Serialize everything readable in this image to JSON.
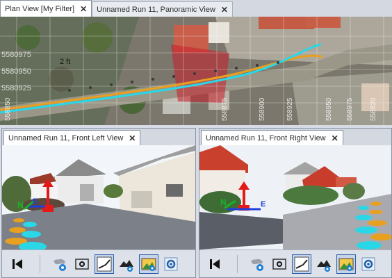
{
  "top_pane": {
    "tabs": [
      {
        "label": "Plan View [My Filter]",
        "close": "✕",
        "active": true
      },
      {
        "label": "Unnamed Run  11, Panoramic View",
        "close": "✕",
        "active": false
      }
    ],
    "grid_labels": {
      "y": [
        "5580975",
        "5580950",
        "5580925"
      ],
      "x": [
        "558850",
        "558875",
        "558900",
        "558925",
        "558950",
        "558975",
        "558820"
      ],
      "marker": "2 ft"
    }
  },
  "left_pane": {
    "tab": {
      "label": "Unnamed Run  11, Front Left View",
      "close": "✕"
    },
    "axis_labels": {
      "north": "N",
      "east": "E"
    }
  },
  "right_pane": {
    "tab": {
      "label": "Unnamed Run  11, Front Right View",
      "close": "✕"
    },
    "axis_labels": {
      "north": "N",
      "east": "E"
    }
  },
  "toolbar_icons": [
    "skip-to-start-icon",
    "map-layers-icon",
    "screenshot-icon",
    "trajectory-icon",
    "point-cloud-icon",
    "image-overlay-icon",
    "settings-icon"
  ],
  "colors": {
    "trajectory_cyan": "#2ad7e6",
    "trajectory_orange": "#e8a020",
    "pressed_border": "#2f5ea8"
  }
}
